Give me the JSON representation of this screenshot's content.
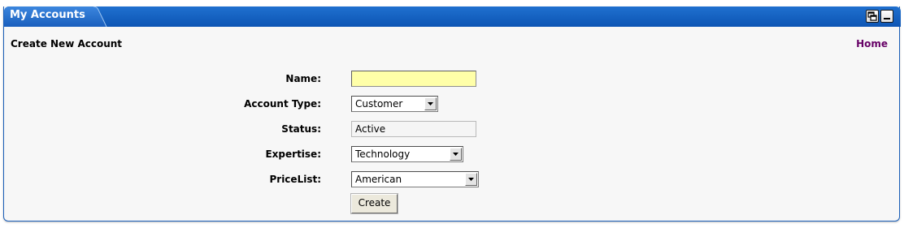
{
  "portlet": {
    "title": "My Accounts",
    "restore_label": "restore",
    "minimize_label": "minimize",
    "accent_color": "#1a62c2"
  },
  "header": {
    "page_title": "Create New Account",
    "home_link": "Home"
  },
  "form": {
    "name": {
      "label": "Name:",
      "value": ""
    },
    "account_type": {
      "label": "Account Type:",
      "value": "Customer"
    },
    "status": {
      "label": "Status:",
      "value": "Active"
    },
    "expertise": {
      "label": "Expertise:",
      "value": "Technology"
    },
    "pricelist": {
      "label": "PriceList:",
      "value": "American"
    },
    "create_button": "Create"
  }
}
